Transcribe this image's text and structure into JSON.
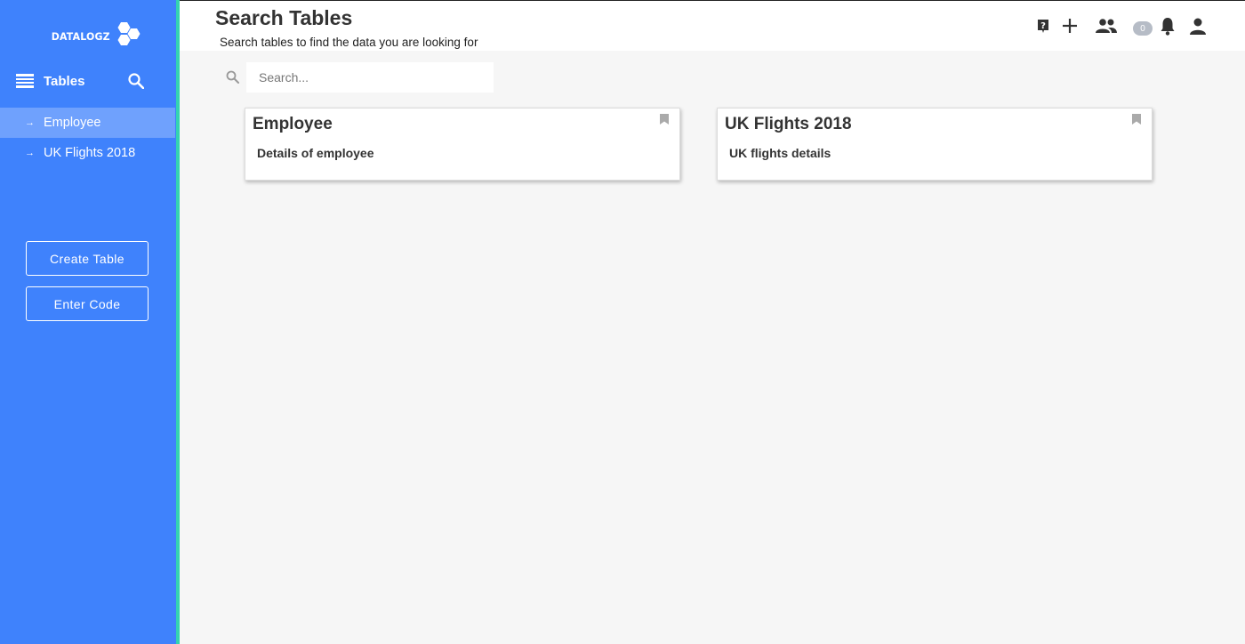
{
  "sidebar": {
    "logo_text": "DATALOGZ",
    "section_label": "Tables",
    "items": [
      {
        "label": "Employee",
        "active": true
      },
      {
        "label": "UK Flights 2018",
        "active": false
      }
    ],
    "buttons": {
      "create_table": "Create Table",
      "enter_code": "Enter Code"
    }
  },
  "header": {
    "title": "Search Tables",
    "subtitle": "Search tables to find the data you are looking for",
    "notification_count": "0",
    "icons": [
      "help-icon",
      "add-icon",
      "people-icon",
      "notification-count-badge",
      "bell-icon",
      "user-icon"
    ]
  },
  "search": {
    "placeholder": "Search..."
  },
  "cards": [
    {
      "title": "Employee",
      "description": "Details of employee"
    },
    {
      "title": "UK Flights 2018",
      "description": "UK flights details"
    }
  ],
  "colors": {
    "sidebar": "#3f82fc",
    "sidebar_accent": "#34d3b1",
    "background": "#f6f6f6"
  }
}
